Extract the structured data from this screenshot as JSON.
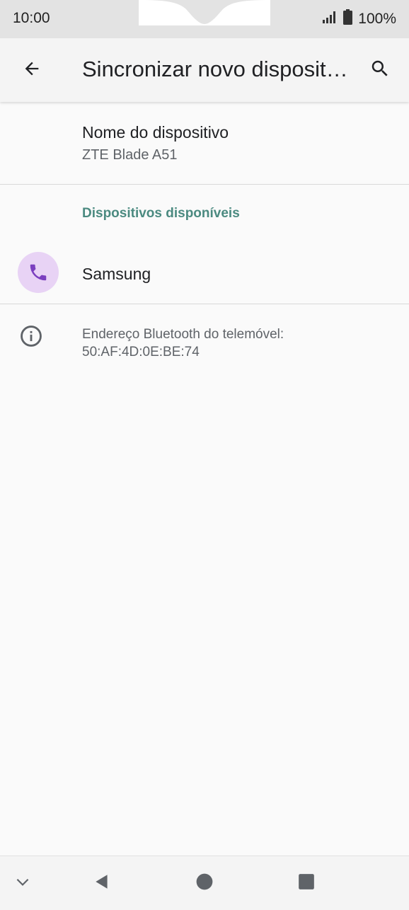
{
  "status_bar": {
    "time": "10:00",
    "battery": "100%",
    "signal_icon": "cell-signal-icon",
    "battery_icon": "battery-icon"
  },
  "app_bar": {
    "title": "Sincronizar novo dispositivo",
    "back_icon": "arrow-back-icon",
    "search_icon": "search-icon"
  },
  "device_name": {
    "title": "Nome do dispositivo",
    "value": "ZTE Blade A51"
  },
  "available_section": {
    "header": "Dispositivos disponíveis",
    "devices": [
      {
        "label": "Samsung",
        "icon": "phone-icon"
      }
    ]
  },
  "info": {
    "icon": "info-icon",
    "text_line1": "Endereço Bluetooth do telemóvel:",
    "text_line2": "50:AF:4D:0E:BE:74"
  },
  "nav_bar": {
    "icons": [
      "chevron-down-icon",
      "back-triangle-icon",
      "home-circle-icon",
      "recents-square-icon"
    ]
  },
  "colors": {
    "accent": "#4b8a80",
    "device_icon_bg": "#e8d3f5",
    "device_icon_fg": "#7b3fbf"
  }
}
